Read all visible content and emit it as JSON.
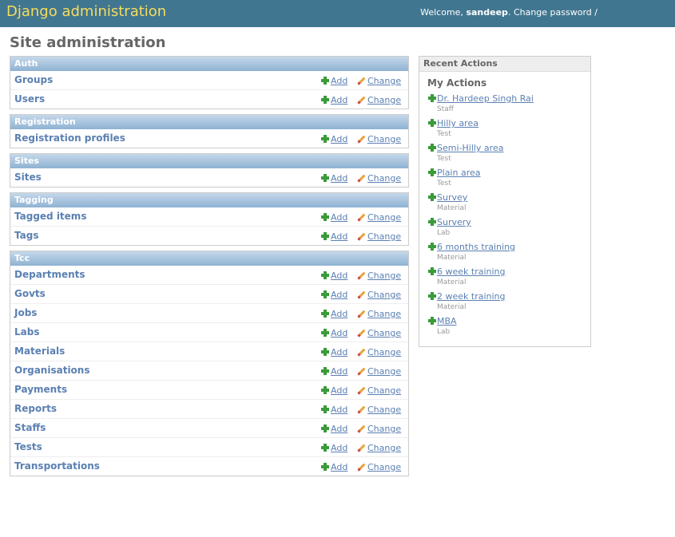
{
  "header": {
    "branding": "Django administration",
    "welcome": "Welcome,",
    "username": "sandeep",
    "change_password": "Change password",
    "separator": "/"
  },
  "page_title": "Site administration",
  "link_labels": {
    "add": "Add",
    "change": "Change"
  },
  "modules": [
    {
      "title": "Auth",
      "models": [
        "Groups",
        "Users"
      ]
    },
    {
      "title": "Registration",
      "models": [
        "Registration profiles"
      ]
    },
    {
      "title": "Sites",
      "models": [
        "Sites"
      ]
    },
    {
      "title": "Tagging",
      "models": [
        "Tagged items",
        "Tags"
      ]
    },
    {
      "title": "Tcc",
      "models": [
        "Departments",
        "Govts",
        "Jobs",
        "Labs",
        "Materials",
        "Organisations",
        "Payments",
        "Reports",
        "Staffs",
        "Tests",
        "Transportations"
      ]
    }
  ],
  "recent": {
    "title": "Recent Actions",
    "subtitle": "My Actions",
    "items": [
      {
        "name": "Dr. Hardeep Singh Rai",
        "type": "Staff"
      },
      {
        "name": "Hilly area",
        "type": "Test"
      },
      {
        "name": "Semi-Hilly area",
        "type": "Test"
      },
      {
        "name": "Plain area",
        "type": "Test"
      },
      {
        "name": "Survey",
        "type": "Material"
      },
      {
        "name": "Survery",
        "type": "Lab"
      },
      {
        "name": "6 months training",
        "type": "Material"
      },
      {
        "name": "6 week training",
        "type": "Material"
      },
      {
        "name": "2 week training",
        "type": "Material"
      },
      {
        "name": "MBA",
        "type": "Lab"
      }
    ]
  },
  "colors": {
    "header_bg": "#417690",
    "branding": "#f5dd5d",
    "link": "#5b80b2",
    "module_head": "#8eb2d3"
  }
}
